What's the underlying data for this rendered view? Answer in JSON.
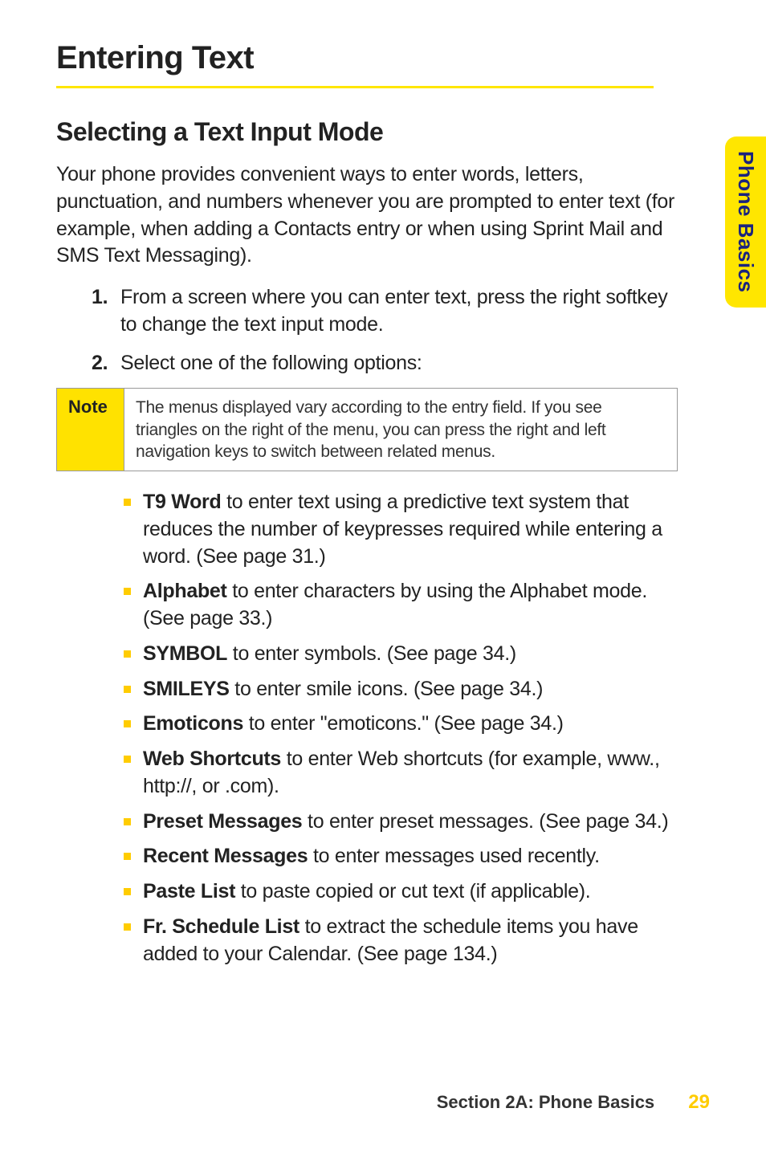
{
  "side_tab": "Phone Basics",
  "page_title": "Entering Text",
  "section_title": "Selecting a Text Input Mode",
  "intro": "Your phone provides convenient ways to enter words, letters, punctuation, and numbers whenever you are prompted to enter text (for example, when adding a Contacts entry or when using Sprint Mail and SMS Text Messaging).",
  "steps": [
    {
      "num": "1.",
      "text": "From a screen where you can enter text, press the right softkey to change the text input mode."
    },
    {
      "num": "2.",
      "text": "Select one of the following options:"
    }
  ],
  "note": {
    "label": "Note",
    "text": "The menus displayed vary according to the entry field. If you see triangles on the right of the menu, you can press the right and left navigation keys to switch between related menus."
  },
  "options": [
    {
      "bold": "T9 Word",
      "rest": " to enter text using a predictive text system that reduces the number of keypresses required while entering a word. (See page 31.)"
    },
    {
      "bold": "Alphabet",
      "rest": " to enter characters by using the Alphabet mode. (See page 33.)"
    },
    {
      "bold": "SYMBOL",
      "rest": " to enter symbols. (See page 34.)"
    },
    {
      "bold": "SMILEYS",
      "rest": " to enter smile icons. (See page 34.)"
    },
    {
      "bold": "Emoticons",
      "rest": " to enter \"emoticons.\" (See page 34.)"
    },
    {
      "bold": "Web Shortcuts",
      "rest": " to enter Web shortcuts (for example, www., http://, or .com)."
    },
    {
      "bold": "Preset Messages",
      "rest": " to enter preset messages. (See page 34.)"
    },
    {
      "bold": "Recent Messages",
      "rest": " to enter messages used recently."
    },
    {
      "bold": "Paste List",
      "rest": " to paste copied or cut text (if applicable)."
    },
    {
      "bold": "Fr. Schedule List",
      "rest": " to extract the schedule items you have added to your Calendar. (See page 134.)"
    }
  ],
  "footer": {
    "section": "Section 2A: Phone Basics",
    "page": "29"
  }
}
